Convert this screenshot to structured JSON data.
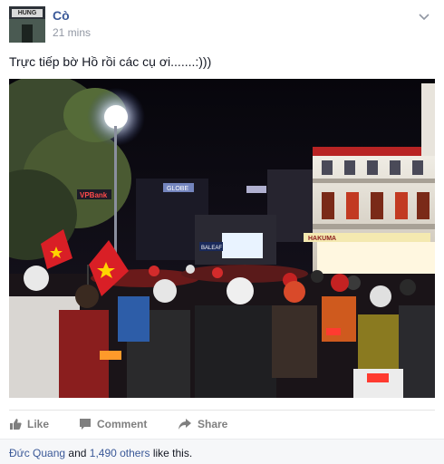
{
  "post": {
    "author": "Cò",
    "timestamp": "21 mins",
    "text": "Trực tiếp bờ Hồ rồi các cụ ơi.......:)))",
    "avatar_sign": "HUNG"
  },
  "actions": {
    "like_label": "Like",
    "comment_label": "Comment",
    "share_label": "Share"
  },
  "likes": {
    "first_name": "Đức Quang",
    "and_text": " and ",
    "others_link": "1,490 others",
    "suffix": " like this."
  },
  "photo": {
    "store_sign": "HAKUMA",
    "shop_sign": "BALEAF",
    "bank_sign": "VPBank",
    "rooftop_sign": "GLOBE"
  },
  "colors": {
    "link": "#3b5998",
    "flag_red": "#d91f26",
    "flag_star": "#ffd400"
  },
  "icons": {
    "menu": "chevron-down-icon",
    "like": "thumbs-up-icon",
    "comment": "speech-bubble-icon",
    "share": "share-arrow-icon"
  }
}
